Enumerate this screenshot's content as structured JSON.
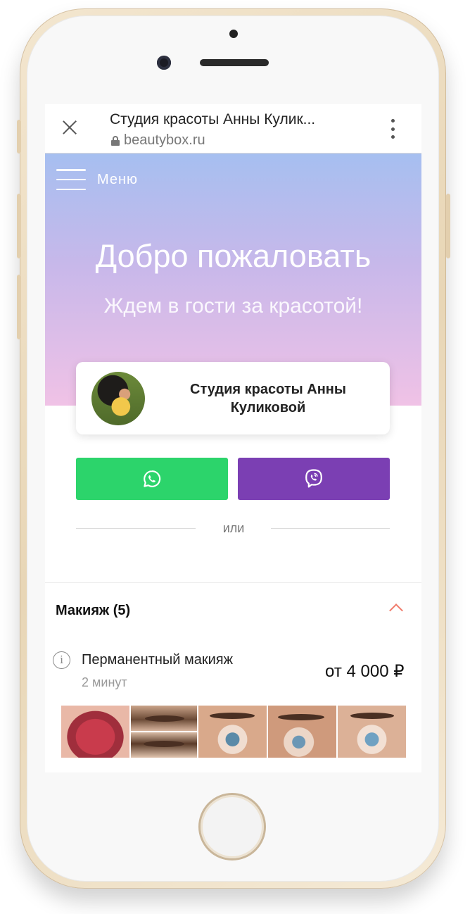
{
  "browser": {
    "page_title": "Студия красоты Анны Кулик...",
    "url": "beautybox.ru"
  },
  "hero": {
    "menu_label": "Меню",
    "title": "Добро пожаловать",
    "subtitle": "Ждем в гости за красотой!"
  },
  "studio": {
    "name": "Студия красоты Анны Куликовой"
  },
  "messengers": {
    "separator": "или"
  },
  "category": {
    "title": "Макияж (5)",
    "services": [
      {
        "name": "Перманентный макияж",
        "duration": "2 минут",
        "price": "от 4 000 ₽"
      }
    ]
  },
  "colors": {
    "whatsapp": "#2cd46b",
    "viber": "#7b3fb3",
    "accent_chevron": "#f07a6a",
    "hero_top": "#a6bff0",
    "hero_bottom": "#f0c2e6"
  }
}
